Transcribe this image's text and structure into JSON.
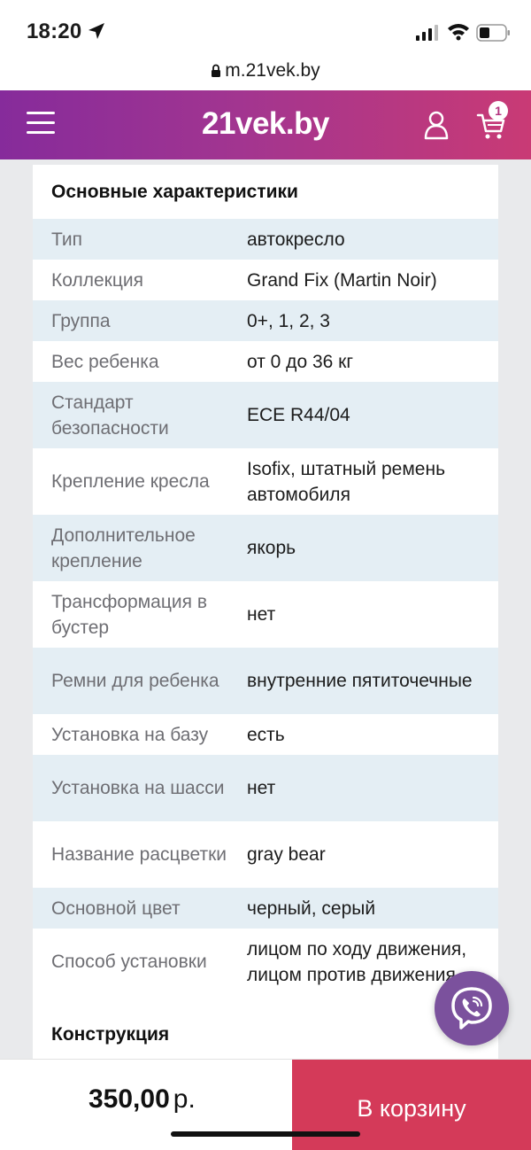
{
  "status_bar": {
    "time": "18:20"
  },
  "browser": {
    "url": "m.21vek.by"
  },
  "header": {
    "logo": "21vek.by",
    "cart_count": "1",
    "brand_gradient": [
      "#862b9b",
      "#c93a75"
    ]
  },
  "specs": {
    "title": "Основные характеристики",
    "rows": [
      {
        "label": "Тип",
        "value": "автокресло"
      },
      {
        "label": "Коллекция",
        "value": "Grand Fix (Martin Noir)"
      },
      {
        "label": "Группа",
        "value": "0+, 1, 2, 3"
      },
      {
        "label": "Вес ребенка",
        "value": "от 0 до 36 кг"
      },
      {
        "label": "Стандарт безопасности",
        "value": "ECE R44/04"
      },
      {
        "label": "Крепление кресла",
        "value": "Isofix, штатный ремень автомобиля"
      },
      {
        "label": "Дополнительное крепление",
        "value": "якорь"
      },
      {
        "label": "Трансформация в бустер",
        "value": "нет"
      },
      {
        "label": "Ремни для ребенка",
        "value": "внутренние пятиточечные"
      },
      {
        "label": "Установка на базу",
        "value": "есть"
      },
      {
        "label": "Установка на шасси",
        "value": "нет"
      },
      {
        "label": "Название расцветки",
        "value": "gray bear"
      },
      {
        "label": "Основной цвет",
        "value": "черный, серый"
      },
      {
        "label": "Способ установки",
        "value": "лицом по ходу движения, лицом против движения"
      }
    ]
  },
  "construction": {
    "title": "Конструкция"
  },
  "purchase": {
    "price": "350,00",
    "currency": "р.",
    "add_to_cart_label": "В корзину",
    "accent_color": "#d43a59"
  },
  "floating": {
    "viber_color": "#7b519d"
  }
}
